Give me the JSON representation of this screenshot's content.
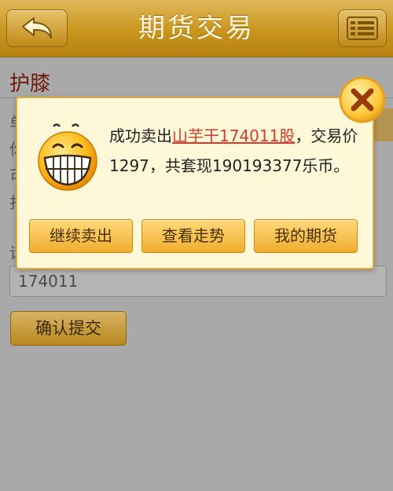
{
  "header": {
    "title": "期货交易"
  },
  "page": {
    "title": "护膝",
    "bg_rows": [
      "单",
      "你",
      "可",
      "打"
    ],
    "input_label": "请",
    "quantity_value": "174011",
    "submit_label": "确认提交"
  },
  "dialog": {
    "msg_prefix": "成功卖出",
    "msg_link": "山芋干174011股",
    "msg_suffix": "，交易价1297，共套现190193377乐币。",
    "buttons": [
      "继续卖出",
      "查看走势",
      "我的期货"
    ]
  },
  "colors": {
    "header": "#c9951d",
    "dialog_bg": "#fff8d8",
    "link": "#d73a2a"
  }
}
